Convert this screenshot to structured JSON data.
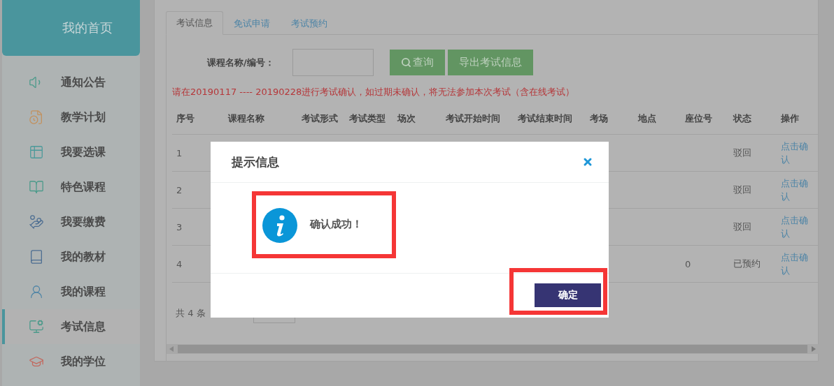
{
  "sidebar": {
    "home": "我的首页",
    "items": [
      {
        "label": "通知公告",
        "selected": false
      },
      {
        "label": "教学计划",
        "selected": false
      },
      {
        "label": "我要选课",
        "selected": false
      },
      {
        "label": "特色课程",
        "selected": false
      },
      {
        "label": "我要缴费",
        "selected": false
      },
      {
        "label": "我的教材",
        "selected": false
      },
      {
        "label": "我的课程",
        "selected": false
      },
      {
        "label": "考试信息",
        "selected": true
      },
      {
        "label": "我的学位",
        "selected": false
      }
    ]
  },
  "tabs": [
    {
      "label": "考试信息",
      "selected": true
    },
    {
      "label": "免试申请",
      "selected": false
    },
    {
      "label": "考试预约",
      "selected": false
    }
  ],
  "search": {
    "label": "课程名称/编号：",
    "query_button": "查询",
    "export_button": "导出考试信息"
  },
  "notice": "请在20190117 ---- 20190228进行考试确认，如过期未确认，将无法参加本次考试（含在线考试）",
  "table": {
    "columns": [
      "序号",
      "课程名称",
      "考试形式",
      "考试类型",
      "场次",
      "考试开始时间",
      "考试结束时间",
      "考场",
      "地点",
      "座位号",
      "状态",
      "操作"
    ],
    "rows": [
      {
        "no": "1",
        "status": "驳回",
        "action": "点击确认"
      },
      {
        "no": "2",
        "status": "驳回",
        "action": "点击确认"
      },
      {
        "no": "3",
        "status": "驳回",
        "action": "点击确认"
      },
      {
        "no": "4",
        "seat": "0",
        "status": "已预约",
        "action": "点击确认"
      }
    ]
  },
  "pagination": {
    "total": "共 4 条"
  },
  "dialog": {
    "title": "提示信息",
    "message": "确认成功！",
    "ok_button": "确定"
  }
}
